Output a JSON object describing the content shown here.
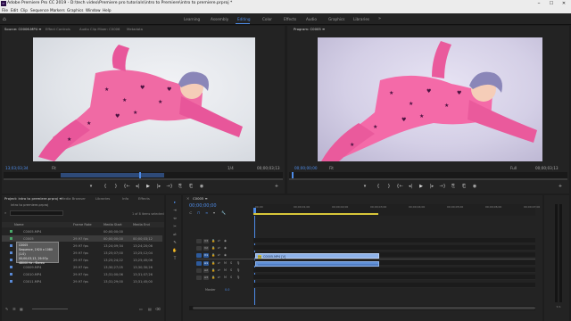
{
  "window": {
    "title": "Adobe Premiere Pro CC 2019 - D:\\tech video\\Premiere pro tutorials\\intro to Premiere\\intro to premiere.prproj *",
    "app_icon": "Pr",
    "minimize": "–",
    "maximize": "☐",
    "close": "✕"
  },
  "menu": [
    "File",
    "Edit",
    "Clip",
    "Sequence",
    "Markers",
    "Graphics",
    "Window",
    "Help"
  ],
  "workspaces": {
    "home_icon": "⌂",
    "items": [
      "Learning",
      "Assembly",
      "Editing",
      "Color",
      "Effects",
      "Audio",
      "Graphics",
      "Libraries"
    ],
    "active": "Editing",
    "overflow": "»"
  },
  "source": {
    "tabs": [
      "Source: C0006.MP4 ≡",
      "Effect Controls",
      "Audio Clip Mixer: C0006",
      "Metadata"
    ],
    "timecode_in": "13;03;03;34",
    "fit": "Fit",
    "fraction": "1/4",
    "timecode_out": "00;00;03;13",
    "clip_label": "C0006.MP4"
  },
  "program": {
    "tab": "Program: C0005 ≡",
    "timecode_in": "00;00;00;00",
    "fit": "Fit",
    "quality": "Full",
    "timecode_out": "00;00;03;13"
  },
  "transport": {
    "marker": "▾",
    "in": "{",
    "out": "}",
    "go_in": "{←",
    "step_back": "◂|",
    "play": "▶",
    "step_fwd": "|▸",
    "go_out": "→}",
    "insert": "⎘",
    "overwrite": "⎗",
    "camera": "◉",
    "add": "+"
  },
  "project": {
    "tabs": [
      "Project: intro to premiere.prproj ≡",
      "Media Browser",
      "Libraries",
      "Info",
      "Effects"
    ],
    "path": "intro to premiere.prproj",
    "search_placeholder": "",
    "count": "1 of 8 items selected",
    "columns": [
      "Name",
      "Frame Rate",
      "Media Start",
      "Media End"
    ],
    "rows": [
      {
        "name": "C0005.MP4",
        "rate": "",
        "start": "00;00;00;00",
        "end": "",
        "color": "#4aa86a"
      },
      {
        "name": "C0005",
        "rate": "29.97 fps",
        "start": "00;00;00;00",
        "end": "00;00;03;12",
        "color": "#4aa86a"
      },
      {
        "name": "C0006.MP4",
        "rate": "29.97 fps",
        "start": "13;24;09;34",
        "end": "13;24;20;06",
        "color": "#5a8ad6"
      },
      {
        "name": "C0007.MP4",
        "rate": "29.97 fps",
        "start": "13;25;07;00",
        "end": "13;25;12;04",
        "color": "#5a8ad6"
      },
      {
        "name": "C0008.MP4",
        "rate": "29.97 fps",
        "start": "13;25;24;22",
        "end": "13;25;45;06",
        "color": "#5a8ad6"
      },
      {
        "name": "C0009.MP4",
        "rate": "29.97 fps",
        "start": "13;30;27;05",
        "end": "13;30;30;26",
        "color": "#5a8ad6"
      },
      {
        "name": "C0010.MP4",
        "rate": "29.97 fps",
        "start": "13;31;00;06",
        "end": "13;31;07;26",
        "color": "#5a8ad6"
      },
      {
        "name": "C0011.MP4",
        "rate": "29.97 fps",
        "start": "13;31;29;00",
        "end": "13;31;45;00",
        "color": "#5a8ad6"
      }
    ],
    "tooltip": [
      "C0005",
      "Sequence, 1920 x 1080 (1.0)",
      "00;00;03;13, 29.97p",
      "48000 Hz - Stereo"
    ]
  },
  "timeline": {
    "tab": "C0005 ≡",
    "timecode": "00;00;00;00",
    "ruler": [
      "00;00",
      "00;00;01;00",
      "00;00;02;00",
      "00;00;03;00",
      "00;00;04;00",
      "00;00;05;00",
      "00;00;06;00",
      "00;00;07;00"
    ],
    "video_tracks": [
      "V3",
      "V2",
      "V1"
    ],
    "audio_tracks": [
      "A1",
      "A2",
      "A3"
    ],
    "master": "Master",
    "master_val": "0.0",
    "clip_label": "C0005.MP4 [V]",
    "fx": "fx"
  },
  "tools": [
    "▸",
    "⇥",
    "⇔",
    "✂",
    "⇌",
    "✎",
    "✋",
    "T"
  ],
  "colors": {
    "accent": "#4e8ce8",
    "video_clip": "#8fb3ea",
    "audio_clip": "#5f8fd6"
  }
}
